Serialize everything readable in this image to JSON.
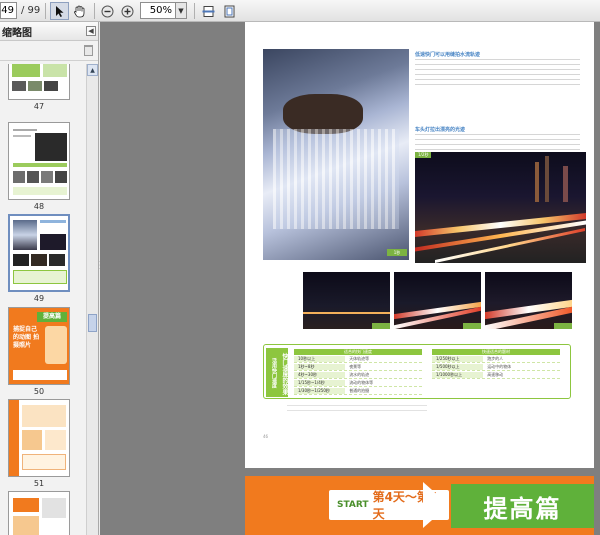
{
  "toolbar": {
    "page_current": "49",
    "page_total": "/ 99",
    "zoom_value": "50%"
  },
  "sidebar": {
    "title": "缩略图",
    "thumbnails": [
      {
        "label": "47"
      },
      {
        "label": "48"
      },
      {
        "label": "49"
      },
      {
        "label": "50"
      },
      {
        "label": "51"
      }
    ],
    "thumb50_text": "提高篇",
    "thumb50_sub": "捕捉自己的动图 拍摄照片"
  },
  "page": {
    "heading1": "低速快门可以用缝拍水流轨迹",
    "heading2": "车头灯拉出漂亮的光迹",
    "night_tag": "1/2秒",
    "tips_title": "快门速度的效果",
    "tips_sub": "活用快门速度",
    "table_left_head": "适合的快门速度",
    "table_right_head": "快速适合的题材",
    "left_rows": [
      {
        "k": "10秒以上",
        "v": "天体轨迹等"
      },
      {
        "k": "1秒~8秒",
        "v": "夜景等"
      },
      {
        "k": "4秒~30秒",
        "v": "流水的轨迹"
      },
      {
        "k": "1/15秒~1/4秒",
        "v": "流动的物体等"
      },
      {
        "k": "1/30秒~1/250秒",
        "v": "普通的拍摄"
      }
    ],
    "right_rows": [
      {
        "k": "1/250秒以上",
        "v": "跑步的人"
      },
      {
        "k": "1/500秒以上",
        "v": "运动中的物体"
      },
      {
        "k": "1/1000秒以上",
        "v": "高速移动"
      }
    ],
    "page_number": "46"
  },
  "page2": {
    "start": "START",
    "days": "第4天～第5天",
    "title": "提高篇"
  }
}
